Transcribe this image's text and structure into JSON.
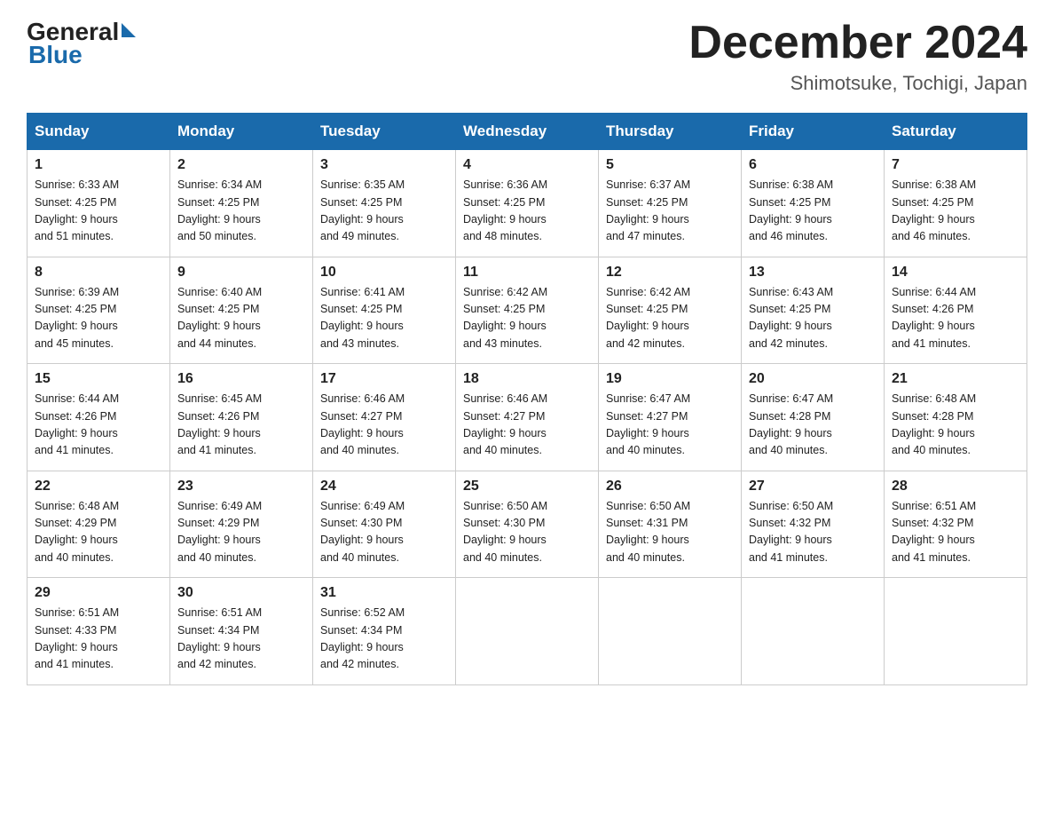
{
  "logo": {
    "general": "General",
    "blue": "Blue",
    "arrow": "▶"
  },
  "title": "December 2024",
  "subtitle": "Shimotsuke, Tochigi, Japan",
  "weekdays": [
    "Sunday",
    "Monday",
    "Tuesday",
    "Wednesday",
    "Thursday",
    "Friday",
    "Saturday"
  ],
  "weeks": [
    [
      {
        "day": "1",
        "sunrise": "6:33 AM",
        "sunset": "4:25 PM",
        "daylight": "9 hours and 51 minutes."
      },
      {
        "day": "2",
        "sunrise": "6:34 AM",
        "sunset": "4:25 PM",
        "daylight": "9 hours and 50 minutes."
      },
      {
        "day": "3",
        "sunrise": "6:35 AM",
        "sunset": "4:25 PM",
        "daylight": "9 hours and 49 minutes."
      },
      {
        "day": "4",
        "sunrise": "6:36 AM",
        "sunset": "4:25 PM",
        "daylight": "9 hours and 48 minutes."
      },
      {
        "day": "5",
        "sunrise": "6:37 AM",
        "sunset": "4:25 PM",
        "daylight": "9 hours and 47 minutes."
      },
      {
        "day": "6",
        "sunrise": "6:38 AM",
        "sunset": "4:25 PM",
        "daylight": "9 hours and 46 minutes."
      },
      {
        "day": "7",
        "sunrise": "6:38 AM",
        "sunset": "4:25 PM",
        "daylight": "9 hours and 46 minutes."
      }
    ],
    [
      {
        "day": "8",
        "sunrise": "6:39 AM",
        "sunset": "4:25 PM",
        "daylight": "9 hours and 45 minutes."
      },
      {
        "day": "9",
        "sunrise": "6:40 AM",
        "sunset": "4:25 PM",
        "daylight": "9 hours and 44 minutes."
      },
      {
        "day": "10",
        "sunrise": "6:41 AM",
        "sunset": "4:25 PM",
        "daylight": "9 hours and 43 minutes."
      },
      {
        "day": "11",
        "sunrise": "6:42 AM",
        "sunset": "4:25 PM",
        "daylight": "9 hours and 43 minutes."
      },
      {
        "day": "12",
        "sunrise": "6:42 AM",
        "sunset": "4:25 PM",
        "daylight": "9 hours and 42 minutes."
      },
      {
        "day": "13",
        "sunrise": "6:43 AM",
        "sunset": "4:25 PM",
        "daylight": "9 hours and 42 minutes."
      },
      {
        "day": "14",
        "sunrise": "6:44 AM",
        "sunset": "4:26 PM",
        "daylight": "9 hours and 41 minutes."
      }
    ],
    [
      {
        "day": "15",
        "sunrise": "6:44 AM",
        "sunset": "4:26 PM",
        "daylight": "9 hours and 41 minutes."
      },
      {
        "day": "16",
        "sunrise": "6:45 AM",
        "sunset": "4:26 PM",
        "daylight": "9 hours and 41 minutes."
      },
      {
        "day": "17",
        "sunrise": "6:46 AM",
        "sunset": "4:27 PM",
        "daylight": "9 hours and 40 minutes."
      },
      {
        "day": "18",
        "sunrise": "6:46 AM",
        "sunset": "4:27 PM",
        "daylight": "9 hours and 40 minutes."
      },
      {
        "day": "19",
        "sunrise": "6:47 AM",
        "sunset": "4:27 PM",
        "daylight": "9 hours and 40 minutes."
      },
      {
        "day": "20",
        "sunrise": "6:47 AM",
        "sunset": "4:28 PM",
        "daylight": "9 hours and 40 minutes."
      },
      {
        "day": "21",
        "sunrise": "6:48 AM",
        "sunset": "4:28 PM",
        "daylight": "9 hours and 40 minutes."
      }
    ],
    [
      {
        "day": "22",
        "sunrise": "6:48 AM",
        "sunset": "4:29 PM",
        "daylight": "9 hours and 40 minutes."
      },
      {
        "day": "23",
        "sunrise": "6:49 AM",
        "sunset": "4:29 PM",
        "daylight": "9 hours and 40 minutes."
      },
      {
        "day": "24",
        "sunrise": "6:49 AM",
        "sunset": "4:30 PM",
        "daylight": "9 hours and 40 minutes."
      },
      {
        "day": "25",
        "sunrise": "6:50 AM",
        "sunset": "4:30 PM",
        "daylight": "9 hours and 40 minutes."
      },
      {
        "day": "26",
        "sunrise": "6:50 AM",
        "sunset": "4:31 PM",
        "daylight": "9 hours and 40 minutes."
      },
      {
        "day": "27",
        "sunrise": "6:50 AM",
        "sunset": "4:32 PM",
        "daylight": "9 hours and 41 minutes."
      },
      {
        "day": "28",
        "sunrise": "6:51 AM",
        "sunset": "4:32 PM",
        "daylight": "9 hours and 41 minutes."
      }
    ],
    [
      {
        "day": "29",
        "sunrise": "6:51 AM",
        "sunset": "4:33 PM",
        "daylight": "9 hours and 41 minutes."
      },
      {
        "day": "30",
        "sunrise": "6:51 AM",
        "sunset": "4:34 PM",
        "daylight": "9 hours and 42 minutes."
      },
      {
        "day": "31",
        "sunrise": "6:52 AM",
        "sunset": "4:34 PM",
        "daylight": "9 hours and 42 minutes."
      },
      null,
      null,
      null,
      null
    ]
  ],
  "labels": {
    "sunrise": "Sunrise:",
    "sunset": "Sunset:",
    "daylight": "Daylight:"
  }
}
